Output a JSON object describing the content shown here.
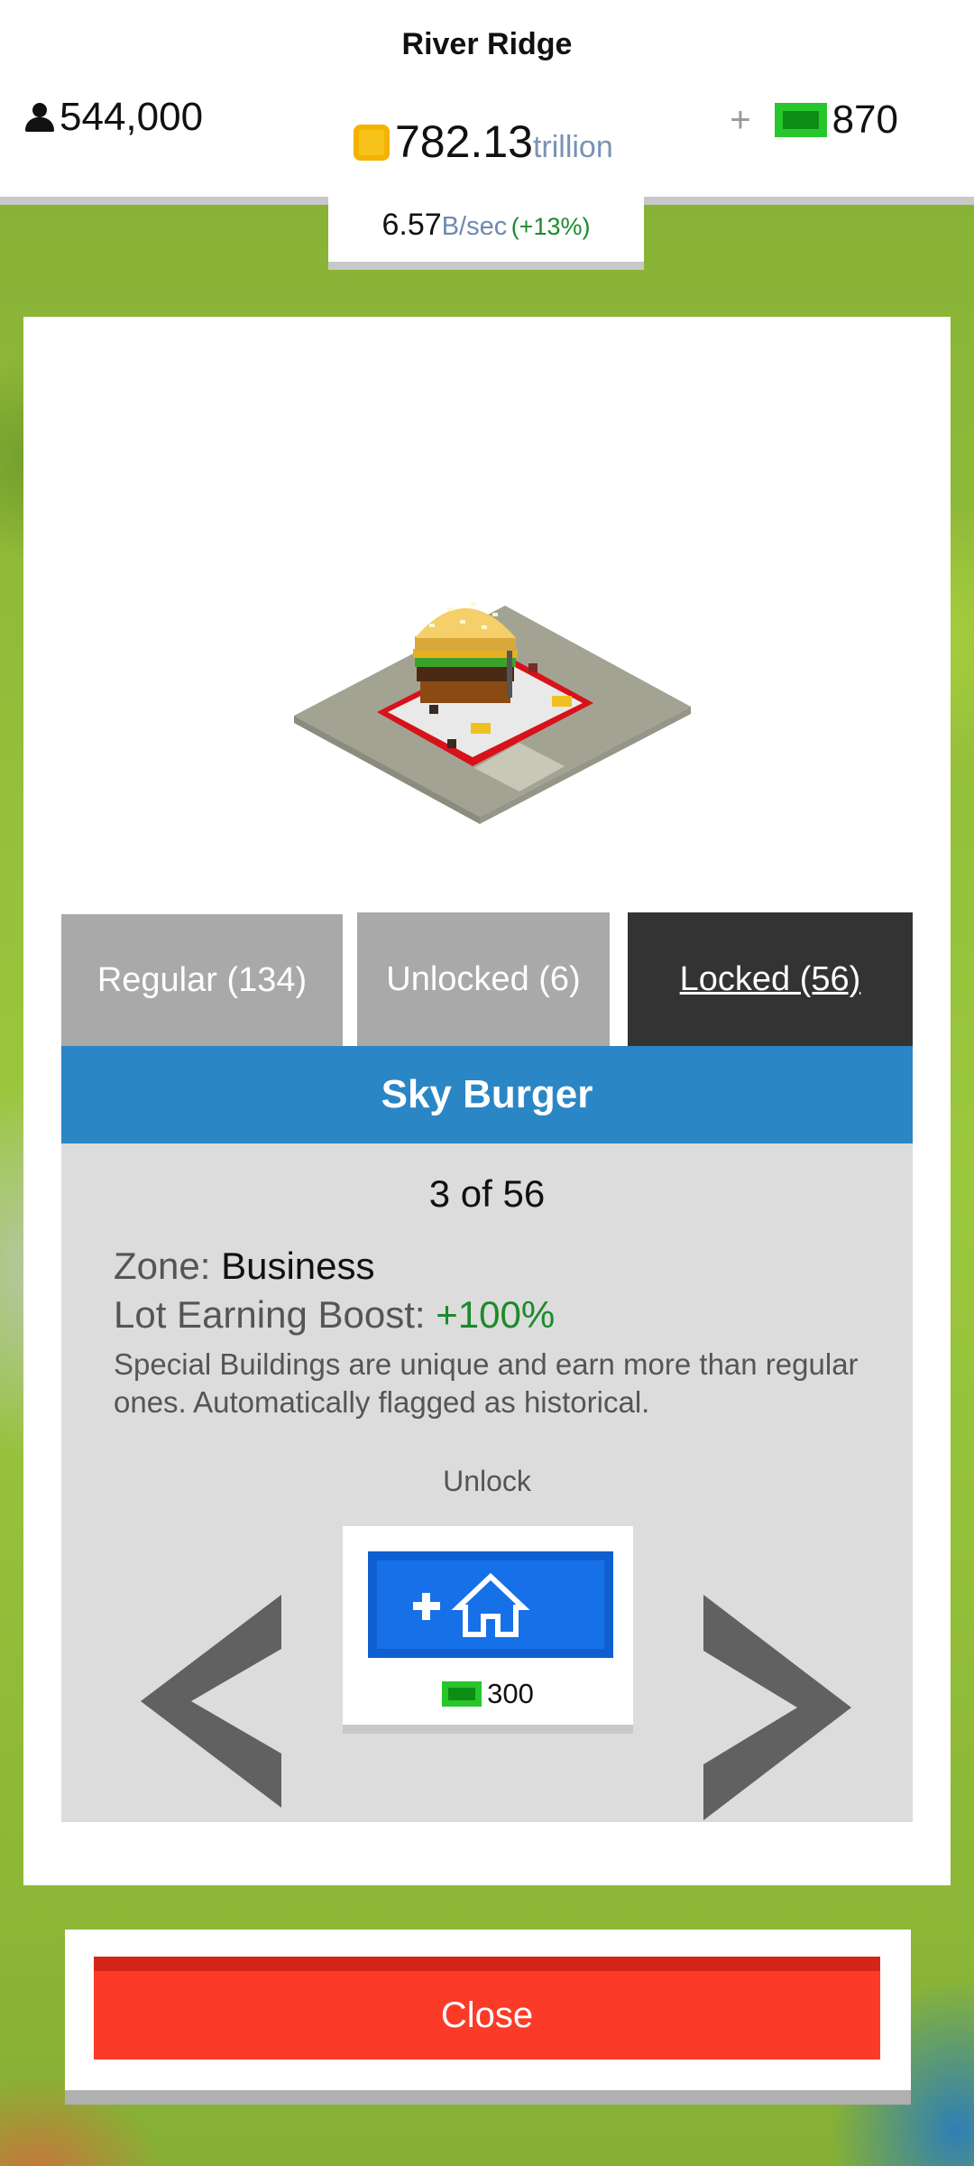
{
  "header": {
    "city_name": "River Ridge",
    "population": "544,000",
    "coins_value": "782.13",
    "coins_unit": "trillion",
    "cash_plus": "+",
    "cash_value": "870",
    "rate_value": "6.57",
    "rate_unit": "B/sec",
    "rate_change": "(+13%)"
  },
  "tabs": [
    {
      "label": "Regular (134)",
      "selected": false
    },
    {
      "label": "Unlocked (6)",
      "selected": false
    },
    {
      "label": "Locked (56)",
      "selected": true
    }
  ],
  "building": {
    "name": "Sky Burger",
    "counter": "3 of 56",
    "zone_label": "Zone:",
    "zone_value": "Business",
    "boost_label": "Lot Earning Boost:",
    "boost_value": "+100%",
    "description": "Special Buildings are unique and earn more than regular ones. Automatically flagged as historical."
  },
  "unlock": {
    "label": "Unlock",
    "cost": "300"
  },
  "close_label": "Close",
  "colors": {
    "tab_inactive": "#a9a9a9",
    "tab_active": "#333333",
    "title_bar": "#2b86c5",
    "unlock_button": "#1670e8",
    "close_button": "#fb3a28",
    "positive_green": "#1c8a2a",
    "cash_green": "#27c62c",
    "coin_gold": "#f7c21a"
  },
  "icons": [
    "person-icon",
    "coin-icon",
    "cash-bill-icon",
    "plus-house-icon",
    "chevron-left-icon",
    "chevron-right-icon",
    "sky-burger-building-image"
  ]
}
